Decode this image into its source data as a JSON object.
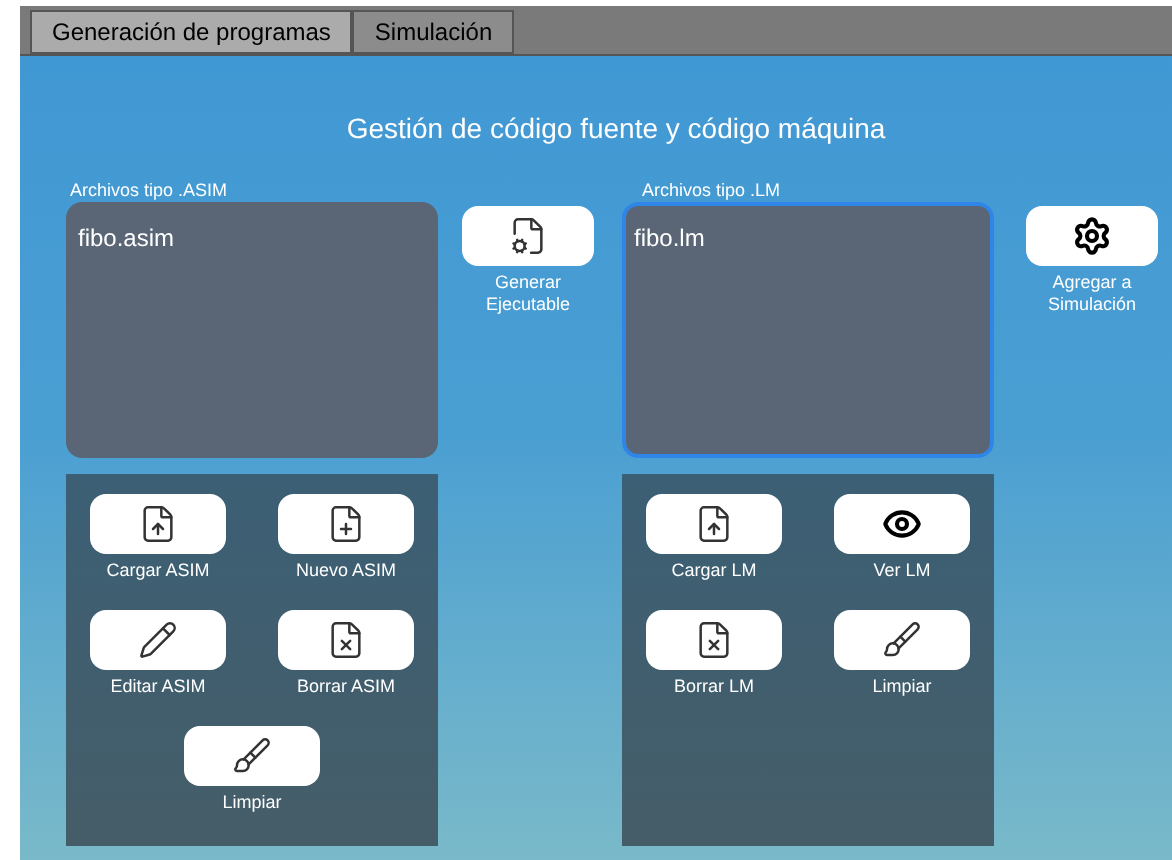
{
  "tabs": [
    {
      "label": "Generación de programas",
      "selected": true
    },
    {
      "label": "Simulación",
      "selected": false
    }
  ],
  "title": "Gestión de código fuente y código máquina",
  "asim": {
    "label": "Archivos tipo .ASIM",
    "focused": false,
    "files": [
      "fibo.asim"
    ],
    "side_button": {
      "kind": "generate",
      "label": [
        "Generar",
        "Ejecutable"
      ]
    },
    "buttons": [
      {
        "kind": "load",
        "label": "Cargar ASIM"
      },
      {
        "kind": "new",
        "label": "Nuevo ASIM"
      },
      {
        "kind": "edit",
        "label": "Editar ASIM"
      },
      {
        "kind": "delete",
        "label": "Borrar ASIM"
      },
      {
        "kind": "clear",
        "label": "Limpiar"
      }
    ]
  },
  "lm": {
    "label": "Archivos tipo .LM",
    "focused": true,
    "files": [
      "fibo.lm"
    ],
    "side_button": {
      "kind": "simulate",
      "label": [
        "Agregar a",
        "Simulación"
      ]
    },
    "buttons": [
      {
        "kind": "load",
        "label": "Cargar LM"
      },
      {
        "kind": "view",
        "label": "Ver LM"
      },
      {
        "kind": "delete",
        "label": "Borrar LM"
      },
      {
        "kind": "clear",
        "label": "Limpiar"
      }
    ]
  }
}
